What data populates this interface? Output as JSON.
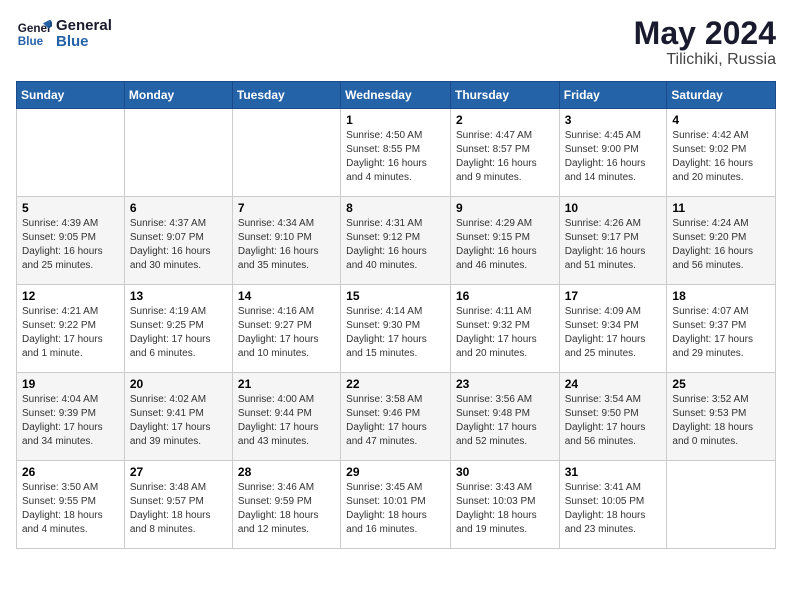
{
  "header": {
    "logo_line1": "General",
    "logo_line2": "Blue",
    "title": "May 2024",
    "subtitle": "Tilichiki, Russia"
  },
  "weekdays": [
    "Sunday",
    "Monday",
    "Tuesday",
    "Wednesday",
    "Thursday",
    "Friday",
    "Saturday"
  ],
  "weeks": [
    [
      {
        "day": "",
        "sunrise": "",
        "sunset": "",
        "daylight": ""
      },
      {
        "day": "",
        "sunrise": "",
        "sunset": "",
        "daylight": ""
      },
      {
        "day": "",
        "sunrise": "",
        "sunset": "",
        "daylight": ""
      },
      {
        "day": "1",
        "sunrise": "Sunrise: 4:50 AM",
        "sunset": "Sunset: 8:55 PM",
        "daylight": "Daylight: 16 hours and 4 minutes."
      },
      {
        "day": "2",
        "sunrise": "Sunrise: 4:47 AM",
        "sunset": "Sunset: 8:57 PM",
        "daylight": "Daylight: 16 hours and 9 minutes."
      },
      {
        "day": "3",
        "sunrise": "Sunrise: 4:45 AM",
        "sunset": "Sunset: 9:00 PM",
        "daylight": "Daylight: 16 hours and 14 minutes."
      },
      {
        "day": "4",
        "sunrise": "Sunrise: 4:42 AM",
        "sunset": "Sunset: 9:02 PM",
        "daylight": "Daylight: 16 hours and 20 minutes."
      }
    ],
    [
      {
        "day": "5",
        "sunrise": "Sunrise: 4:39 AM",
        "sunset": "Sunset: 9:05 PM",
        "daylight": "Daylight: 16 hours and 25 minutes."
      },
      {
        "day": "6",
        "sunrise": "Sunrise: 4:37 AM",
        "sunset": "Sunset: 9:07 PM",
        "daylight": "Daylight: 16 hours and 30 minutes."
      },
      {
        "day": "7",
        "sunrise": "Sunrise: 4:34 AM",
        "sunset": "Sunset: 9:10 PM",
        "daylight": "Daylight: 16 hours and 35 minutes."
      },
      {
        "day": "8",
        "sunrise": "Sunrise: 4:31 AM",
        "sunset": "Sunset: 9:12 PM",
        "daylight": "Daylight: 16 hours and 40 minutes."
      },
      {
        "day": "9",
        "sunrise": "Sunrise: 4:29 AM",
        "sunset": "Sunset: 9:15 PM",
        "daylight": "Daylight: 16 hours and 46 minutes."
      },
      {
        "day": "10",
        "sunrise": "Sunrise: 4:26 AM",
        "sunset": "Sunset: 9:17 PM",
        "daylight": "Daylight: 16 hours and 51 minutes."
      },
      {
        "day": "11",
        "sunrise": "Sunrise: 4:24 AM",
        "sunset": "Sunset: 9:20 PM",
        "daylight": "Daylight: 16 hours and 56 minutes."
      }
    ],
    [
      {
        "day": "12",
        "sunrise": "Sunrise: 4:21 AM",
        "sunset": "Sunset: 9:22 PM",
        "daylight": "Daylight: 17 hours and 1 minute."
      },
      {
        "day": "13",
        "sunrise": "Sunrise: 4:19 AM",
        "sunset": "Sunset: 9:25 PM",
        "daylight": "Daylight: 17 hours and 6 minutes."
      },
      {
        "day": "14",
        "sunrise": "Sunrise: 4:16 AM",
        "sunset": "Sunset: 9:27 PM",
        "daylight": "Daylight: 17 hours and 10 minutes."
      },
      {
        "day": "15",
        "sunrise": "Sunrise: 4:14 AM",
        "sunset": "Sunset: 9:30 PM",
        "daylight": "Daylight: 17 hours and 15 minutes."
      },
      {
        "day": "16",
        "sunrise": "Sunrise: 4:11 AM",
        "sunset": "Sunset: 9:32 PM",
        "daylight": "Daylight: 17 hours and 20 minutes."
      },
      {
        "day": "17",
        "sunrise": "Sunrise: 4:09 AM",
        "sunset": "Sunset: 9:34 PM",
        "daylight": "Daylight: 17 hours and 25 minutes."
      },
      {
        "day": "18",
        "sunrise": "Sunrise: 4:07 AM",
        "sunset": "Sunset: 9:37 PM",
        "daylight": "Daylight: 17 hours and 29 minutes."
      }
    ],
    [
      {
        "day": "19",
        "sunrise": "Sunrise: 4:04 AM",
        "sunset": "Sunset: 9:39 PM",
        "daylight": "Daylight: 17 hours and 34 minutes."
      },
      {
        "day": "20",
        "sunrise": "Sunrise: 4:02 AM",
        "sunset": "Sunset: 9:41 PM",
        "daylight": "Daylight: 17 hours and 39 minutes."
      },
      {
        "day": "21",
        "sunrise": "Sunrise: 4:00 AM",
        "sunset": "Sunset: 9:44 PM",
        "daylight": "Daylight: 17 hours and 43 minutes."
      },
      {
        "day": "22",
        "sunrise": "Sunrise: 3:58 AM",
        "sunset": "Sunset: 9:46 PM",
        "daylight": "Daylight: 17 hours and 47 minutes."
      },
      {
        "day": "23",
        "sunrise": "Sunrise: 3:56 AM",
        "sunset": "Sunset: 9:48 PM",
        "daylight": "Daylight: 17 hours and 52 minutes."
      },
      {
        "day": "24",
        "sunrise": "Sunrise: 3:54 AM",
        "sunset": "Sunset: 9:50 PM",
        "daylight": "Daylight: 17 hours and 56 minutes."
      },
      {
        "day": "25",
        "sunrise": "Sunrise: 3:52 AM",
        "sunset": "Sunset: 9:53 PM",
        "daylight": "Daylight: 18 hours and 0 minutes."
      }
    ],
    [
      {
        "day": "26",
        "sunrise": "Sunrise: 3:50 AM",
        "sunset": "Sunset: 9:55 PM",
        "daylight": "Daylight: 18 hours and 4 minutes."
      },
      {
        "day": "27",
        "sunrise": "Sunrise: 3:48 AM",
        "sunset": "Sunset: 9:57 PM",
        "daylight": "Daylight: 18 hours and 8 minutes."
      },
      {
        "day": "28",
        "sunrise": "Sunrise: 3:46 AM",
        "sunset": "Sunset: 9:59 PM",
        "daylight": "Daylight: 18 hours and 12 minutes."
      },
      {
        "day": "29",
        "sunrise": "Sunrise: 3:45 AM",
        "sunset": "Sunset: 10:01 PM",
        "daylight": "Daylight: 18 hours and 16 minutes."
      },
      {
        "day": "30",
        "sunrise": "Sunrise: 3:43 AM",
        "sunset": "Sunset: 10:03 PM",
        "daylight": "Daylight: 18 hours and 19 minutes."
      },
      {
        "day": "31",
        "sunrise": "Sunrise: 3:41 AM",
        "sunset": "Sunset: 10:05 PM",
        "daylight": "Daylight: 18 hours and 23 minutes."
      },
      {
        "day": "",
        "sunrise": "",
        "sunset": "",
        "daylight": ""
      }
    ]
  ]
}
